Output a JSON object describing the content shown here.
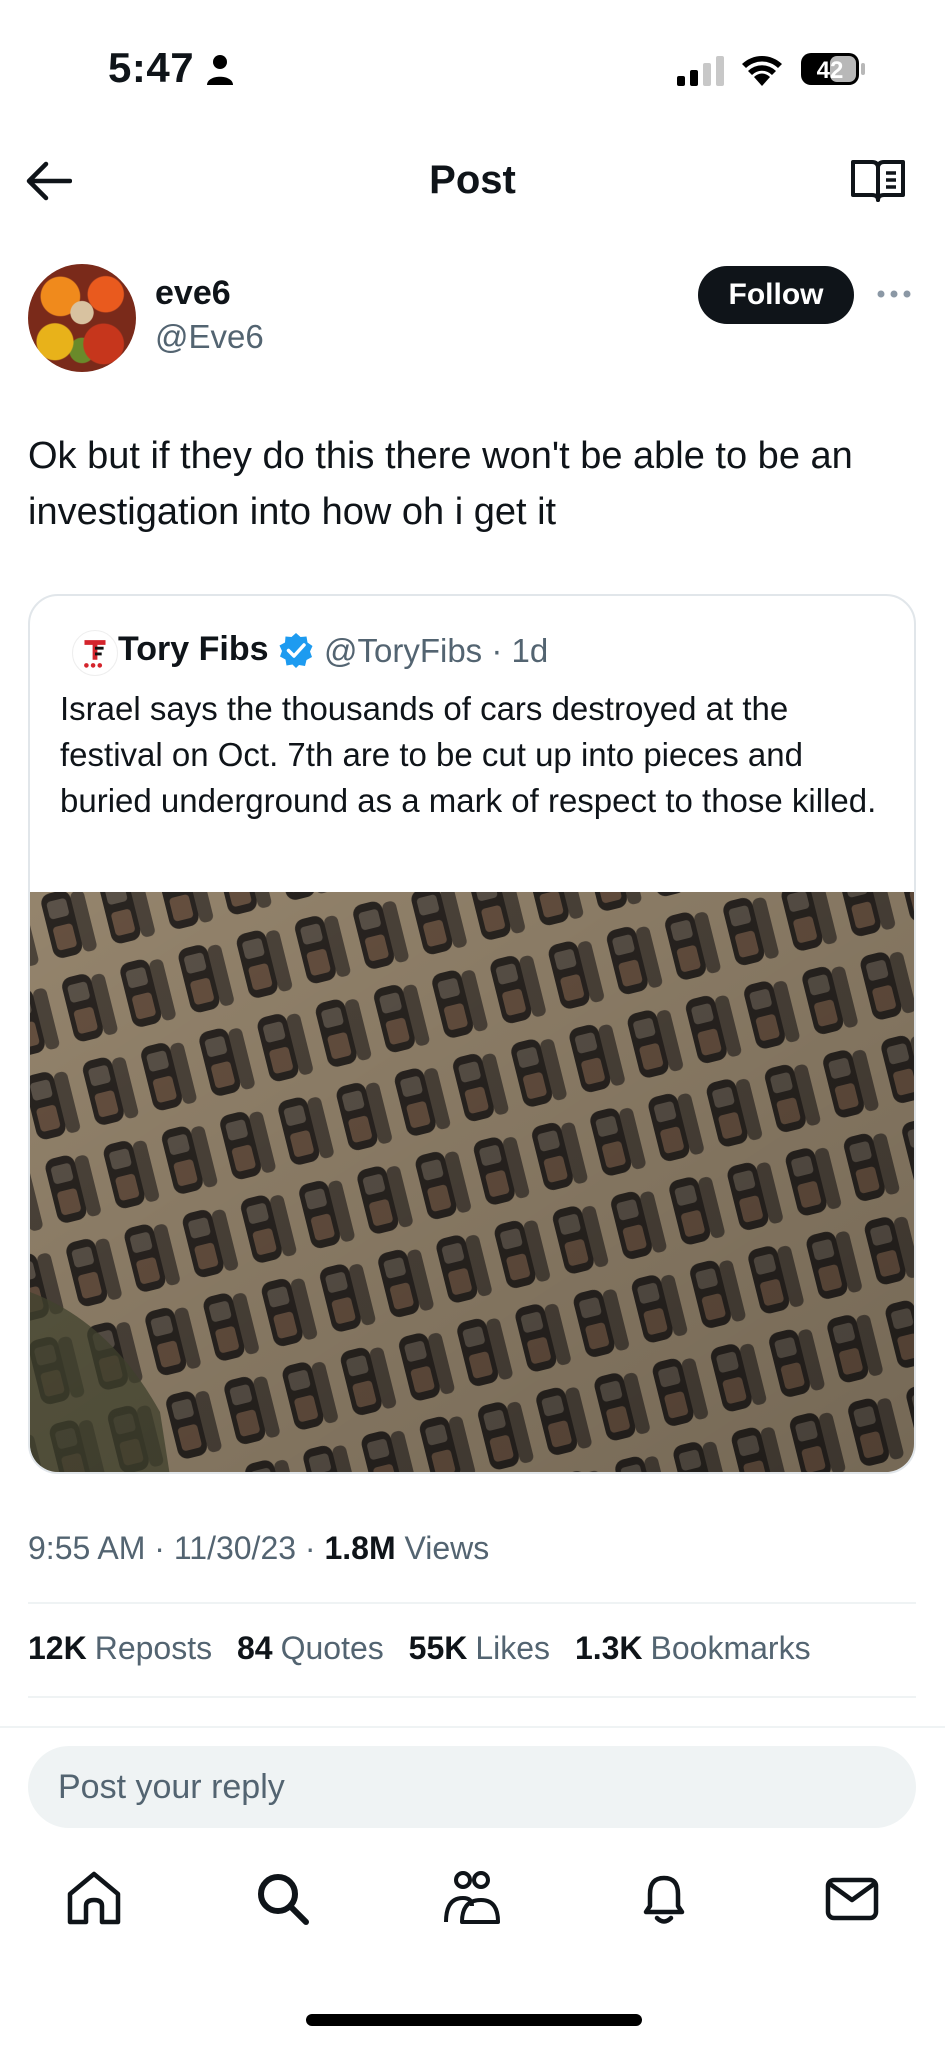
{
  "status_bar": {
    "time": "5:47",
    "battery_level": "42"
  },
  "header": {
    "title": "Post"
  },
  "author": {
    "name": "eve6",
    "handle": "@Eve6",
    "follow_label": "Follow"
  },
  "post": {
    "text": "Ok but if they do this there won't be able to be an investigation into how oh i get it"
  },
  "quote": {
    "name": "Tory Fibs",
    "handle": "@ToryFibs",
    "age": "· 1d",
    "text": "Israel says the thousands of cars destroyed at the festival on Oct. 7th are to be cut up into pieces and buried underground as a mark of respect to those killed."
  },
  "meta": {
    "time": "9:55 AM",
    "date": "11/30/23",
    "views_count": "1.8M",
    "views_label": "Views"
  },
  "stats": [
    {
      "count": "12K",
      "label": "Reposts"
    },
    {
      "count": "84",
      "label": "Quotes"
    },
    {
      "count": "55K",
      "label": "Likes"
    },
    {
      "count": "1.3K",
      "label": "Bookmarks"
    }
  ],
  "reply": {
    "placeholder": "Post your reply"
  },
  "nav": [
    "home-icon",
    "search-icon",
    "communities-icon",
    "notifications-icon",
    "messages-icon"
  ],
  "colors": {
    "text": "#0f1419",
    "secondary": "#536471",
    "verified": "#1d9bf0",
    "follow_bg": "#0f1419"
  }
}
